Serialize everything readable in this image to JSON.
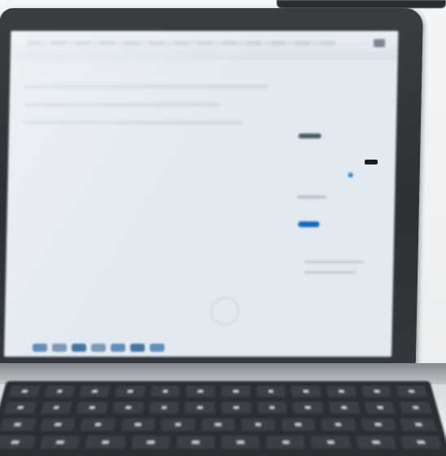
{
  "scene": {
    "description_visible_text": ""
  },
  "colors": {
    "bezel": "#2d3034",
    "screen": "#e2e9f0",
    "accent_blue": "#1565c0",
    "keyboard": "#2b2e32"
  },
  "icons": {
    "toolbar": "window-control-icon",
    "spinner": "loading-spinner-icon"
  }
}
